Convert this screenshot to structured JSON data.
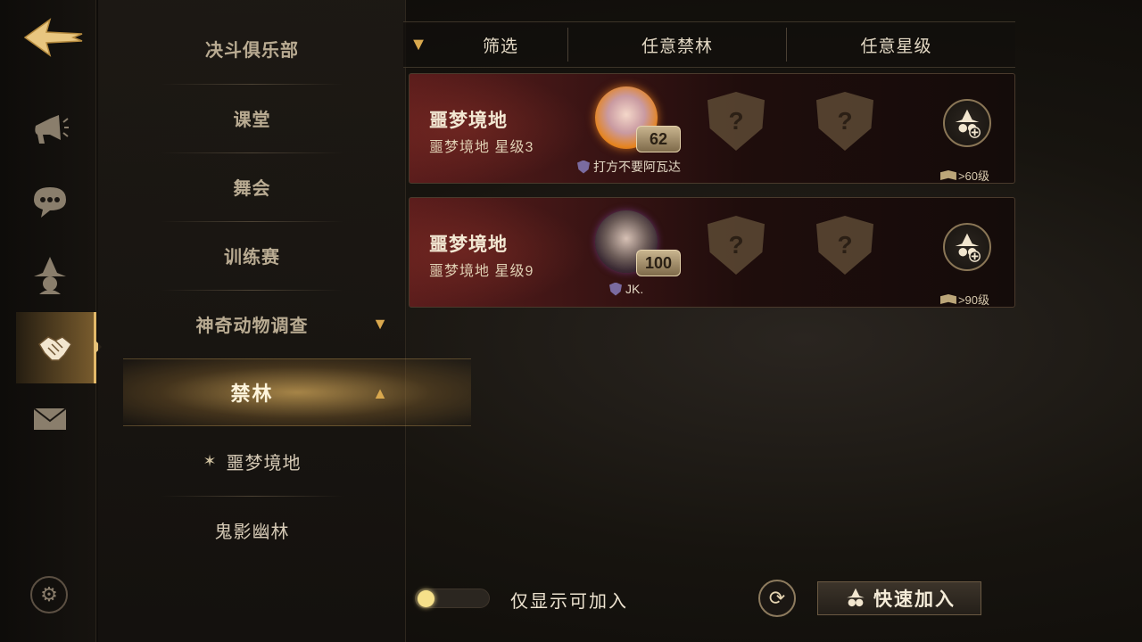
{
  "sidebar": {
    "icons": [
      "back-arrow-icon",
      "megaphone-icon",
      "chat-bubble-icon",
      "wizard-hat-icon",
      "handshake-icon",
      "envelope-icon",
      "gear-icon"
    ],
    "active": "handshake-icon"
  },
  "menu": {
    "items": [
      {
        "label": "决斗俱乐部"
      },
      {
        "label": "课堂"
      },
      {
        "label": "舞会"
      },
      {
        "label": "训练赛"
      },
      {
        "label": "神奇动物调查"
      },
      {
        "label": "禁林"
      },
      {
        "label": "噩梦境地"
      },
      {
        "label": "鬼影幽林"
      }
    ],
    "active_label": "禁林",
    "active_sub": "噩梦境地"
  },
  "filter": {
    "label": "筛选",
    "forest": "任意禁林",
    "stars": "任意星级"
  },
  "rooms": [
    {
      "title": "噩梦境地",
      "subtitle": "噩梦境地 星级3",
      "host_level": "62",
      "host_name": "打方不要阿瓦达",
      "requirement": ">60级",
      "slots": [
        "?",
        "?"
      ]
    },
    {
      "title": "噩梦境地",
      "subtitle": "噩梦境地 星级9",
      "host_level": "100",
      "host_name": "JK.",
      "requirement": ">90级",
      "slots": [
        "?",
        "?"
      ]
    }
  ],
  "footer": {
    "toggle_label": "仅显示可加入",
    "toggle_on": false,
    "quick_join": "快速加入"
  },
  "colors": {
    "accent_gold": "#d9a84e",
    "card_red": "#5c1d1c",
    "text_light": "#f3e8d3"
  }
}
